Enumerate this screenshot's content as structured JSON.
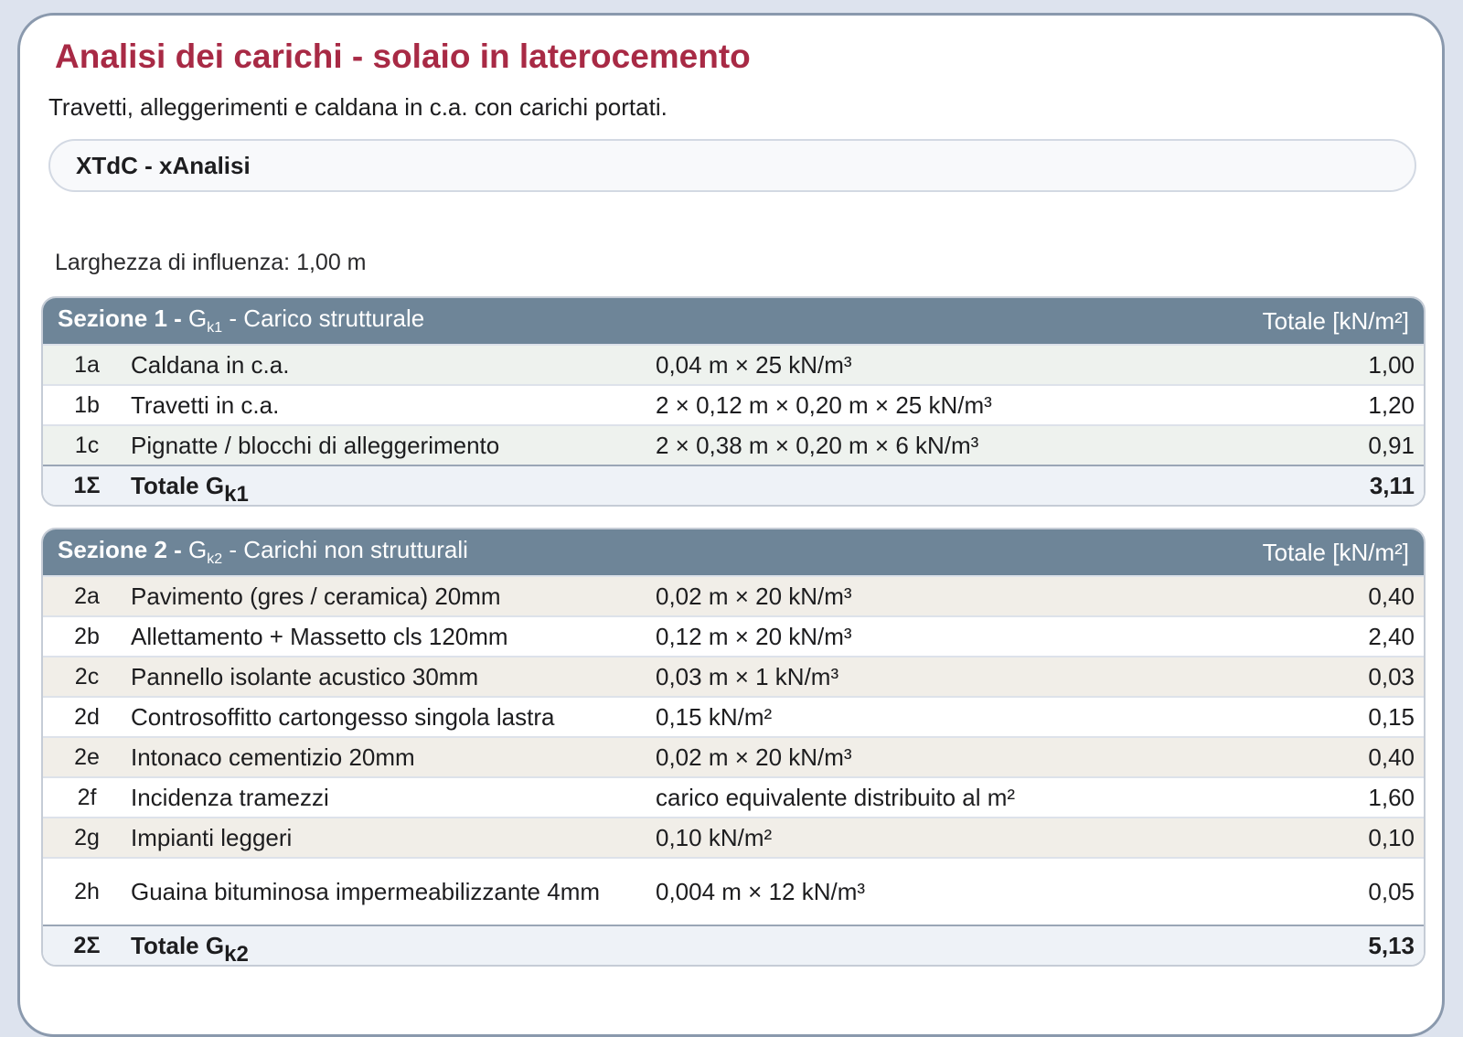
{
  "page": {
    "title": "Analisi dei carichi - solaio in laterocemento",
    "subtitle": "Travetti, alleggerimenti e caldana in c.a. con carichi portati.",
    "app_label": "XTdC - xAnalisi",
    "influence_width": "Larghezza di influenza: 1,00 m"
  },
  "sections": [
    {
      "head_bold": "Sezione 1 -",
      "head_g": " G",
      "head_sub": "k1",
      "head_rest": " - Carico strutturale",
      "unit_header": "Totale [kN/m²]",
      "rows": [
        {
          "code": "1a",
          "desc": "Caldana in c.a.",
          "formula": "0,04 m × 25 kN/m³",
          "value": "1,00"
        },
        {
          "code": "1b",
          "desc": "Travetti in c.a.",
          "formula": "2 × 0,12 m × 0,20 m × 25 kN/m³",
          "value": "1,20"
        },
        {
          "code": "1c",
          "desc": "Pignatte / blocchi di alleggerimento",
          "formula": "2 × 0,38 m × 0,20 m × 6 kN/m³",
          "value": "0,91"
        }
      ],
      "total": {
        "code": "1Σ",
        "label": "Totale G",
        "sub": "k1",
        "value": "3,11"
      }
    },
    {
      "head_bold": "Sezione 2 -",
      "head_g": " G",
      "head_sub": "k2",
      "head_rest": " - Carichi non strutturali",
      "unit_header": "Totale [kN/m²]",
      "rows": [
        {
          "code": "2a",
          "desc": "Pavimento (gres / ceramica) 20mm",
          "formula": "0,02 m × 20 kN/m³",
          "value": "0,40"
        },
        {
          "code": "2b",
          "desc": "Allettamento + Massetto cls 120mm",
          "formula": "0,12 m × 20 kN/m³",
          "value": "2,40"
        },
        {
          "code": "2c",
          "desc": "Pannello isolante acustico 30mm",
          "formula": "0,03 m × 1 kN/m³",
          "value": "0,03"
        },
        {
          "code": "2d",
          "desc": "Controsoffitto cartongesso singola lastra",
          "formula": "0,15 kN/m²",
          "value": "0,15"
        },
        {
          "code": "2e",
          "desc": "Intonaco cementizio 20mm",
          "formula": "0,02 m × 20 kN/m³",
          "value": "0,40"
        },
        {
          "code": "2f",
          "desc": "Incidenza tramezzi",
          "formula": "carico equivalente distribuito al m²",
          "value": "1,60"
        },
        {
          "code": "2g",
          "desc": "Impianti leggeri",
          "formula": "0,10 kN/m²",
          "value": "0,10"
        },
        {
          "code": "2h",
          "desc": "Guaina bituminosa impermeabilizzante 4mm",
          "formula": "0,004 m × 12 kN/m³",
          "value": "0,05"
        }
      ],
      "total": {
        "code": "2Σ",
        "label": "Totale G",
        "sub": "k2",
        "value": "5,13"
      }
    }
  ],
  "colors": {
    "title": "#a82a45",
    "section_header": "#6e8598",
    "row_alt_section1": "#eef2ee",
    "row_alt_section2": "#f1eee8"
  }
}
